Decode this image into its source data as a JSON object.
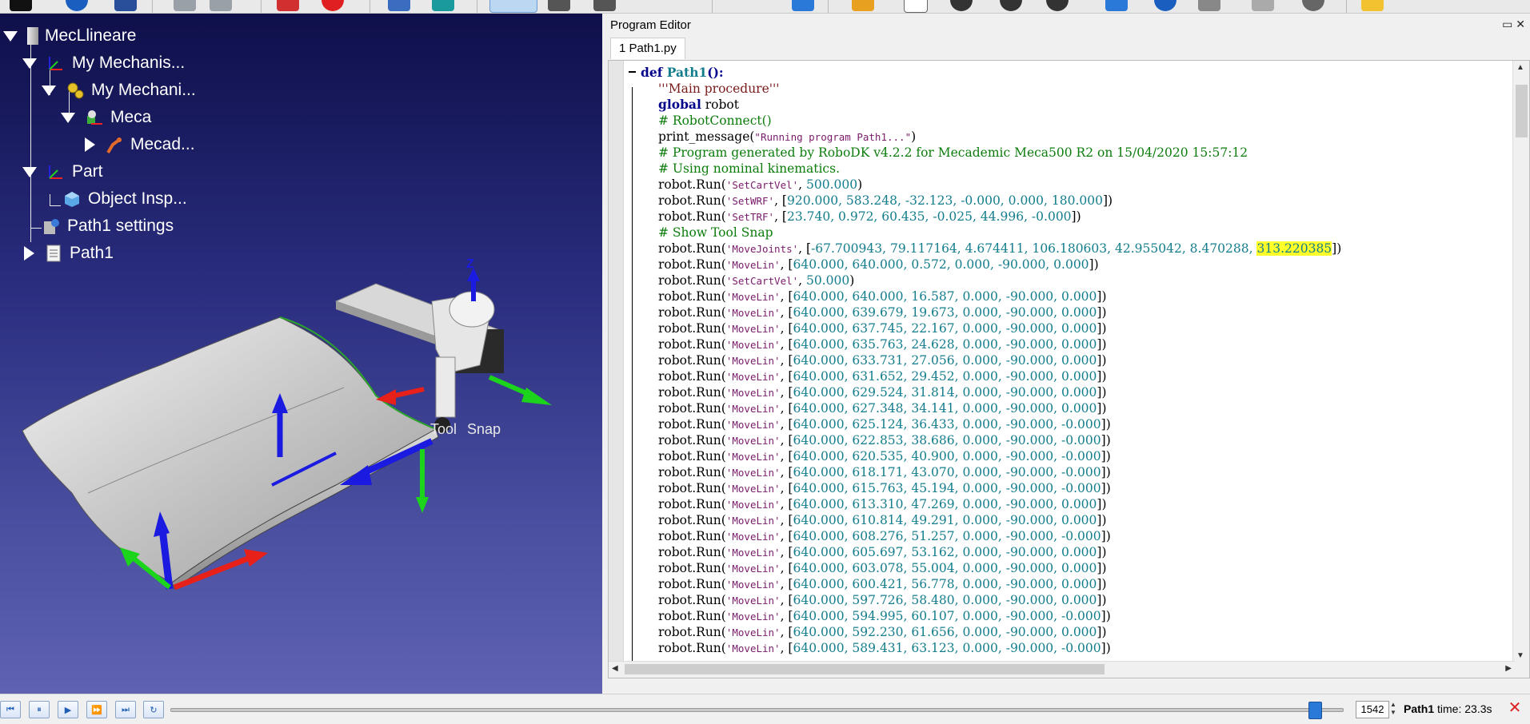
{
  "tree": {
    "items": [
      {
        "label": "MecLlineare"
      },
      {
        "label": "My Mechanis..."
      },
      {
        "label": "My Mechani..."
      },
      {
        "label": "Meca"
      },
      {
        "label": "Mecad..."
      },
      {
        "label": "Part"
      },
      {
        "label": "Object Insp..."
      },
      {
        "label": "Path1 settings"
      },
      {
        "label": "Path1"
      }
    ]
  },
  "viewport": {
    "tool_label": "Tool",
    "snap_label": "Snap",
    "colors": {
      "x_axis": "#e8201a",
      "y_axis": "#1bd41b",
      "z_axis": "#1a1ae0",
      "background": "#2a2d7e"
    }
  },
  "editor": {
    "title": "Program Editor",
    "window_buttons": "▭ ✕",
    "tab": "1 Path1.py",
    "highlight_color": "#ffff2a",
    "lines": {
      "l0": {
        "kw": "def ",
        "fn": "Path1",
        "rest": "():"
      },
      "l1": "'''Main procedure'''",
      "l2": {
        "kw": "global",
        "rest": " robot"
      },
      "l3": "# RobotConnect()",
      "l4": {
        "pre": "print_message(",
        "str": "\"Running program Path1...\"",
        "post": ")"
      },
      "l5": "# Program generated by RoboDK v4.2.2 for Mecademic Meca500 R2 on 15/04/2020 15:57:12",
      "l6": "# Using nominal kinematics.",
      "l7": {
        "str": "'SetCartVel'",
        "args": "500.000",
        "post": ")"
      },
      "l8": {
        "str": "'SetWRF'",
        "args": "920.000, 583.248, -32.123, -0.000, 0.000, 180.000",
        "post": "])"
      },
      "l9": {
        "str": "'SetTRF'",
        "args": "23.740, 0.972, 60.435, -0.025, 44.996, -0.000",
        "post": "])"
      },
      "l10": "# Show Tool Snap",
      "l11": {
        "str": "'MoveJoints'",
        "args": "-67.700943, 79.117164, 4.674411, 106.180603, 42.955042, 8.470288, ",
        "hl": "313.220385",
        "post": "])"
      },
      "l12": {
        "str": "'MoveLin'",
        "args": "640.000, 640.000, 0.572, 0.000, -90.000, 0.000",
        "post": "])"
      },
      "l13": {
        "str": "'SetCartVel'",
        "args": "50.000",
        "post": ")"
      },
      "l14": {
        "str": "'MoveLin'",
        "args": "640.000, 640.000, 16.587, 0.000, -90.000, 0.000",
        "post": "])"
      },
      "l15": {
        "str": "'MoveLin'",
        "args": "640.000, 639.679, 19.673, 0.000, -90.000, 0.000",
        "post": "])"
      },
      "l16": {
        "str": "'MoveLin'",
        "args": "640.000, 637.745, 22.167, 0.000, -90.000, 0.000",
        "post": "])"
      },
      "l17": {
        "str": "'MoveLin'",
        "args": "640.000, 635.763, 24.628, 0.000, -90.000, 0.000",
        "post": "])"
      },
      "l18": {
        "str": "'MoveLin'",
        "args": "640.000, 633.731, 27.056, 0.000, -90.000, 0.000",
        "post": "])"
      },
      "l19": {
        "str": "'MoveLin'",
        "args": "640.000, 631.652, 29.452, 0.000, -90.000, 0.000",
        "post": "])"
      },
      "l20": {
        "str": "'MoveLin'",
        "args": "640.000, 629.524, 31.814, 0.000, -90.000, 0.000",
        "post": "])"
      },
      "l21": {
        "str": "'MoveLin'",
        "args": "640.000, 627.348, 34.141, 0.000, -90.000, 0.000",
        "post": "])"
      },
      "l22": {
        "str": "'MoveLin'",
        "args": "640.000, 625.124, 36.433, 0.000, -90.000, -0.000",
        "post": "])"
      },
      "l23": {
        "str": "'MoveLin'",
        "args": "640.000, 622.853, 38.686, 0.000, -90.000, -0.000",
        "post": "])"
      },
      "l24": {
        "str": "'MoveLin'",
        "args": "640.000, 620.535, 40.900, 0.000, -90.000, -0.000",
        "post": "])"
      },
      "l25": {
        "str": "'MoveLin'",
        "args": "640.000, 618.171, 43.070, 0.000, -90.000, -0.000",
        "post": "])"
      },
      "l26": {
        "str": "'MoveLin'",
        "args": "640.000, 615.763, 45.194, 0.000, -90.000, -0.000",
        "post": "])"
      },
      "l27": {
        "str": "'MoveLin'",
        "args": "640.000, 613.310, 47.269, 0.000, -90.000, 0.000",
        "post": "])"
      },
      "l28": {
        "str": "'MoveLin'",
        "args": "640.000, 610.814, 49.291, 0.000, -90.000, 0.000",
        "post": "])"
      },
      "l29": {
        "str": "'MoveLin'",
        "args": "640.000, 608.276, 51.257, 0.000, -90.000, -0.000",
        "post": "])"
      },
      "l30": {
        "str": "'MoveLin'",
        "args": "640.000, 605.697, 53.162, 0.000, -90.000, 0.000",
        "post": "])"
      },
      "l31": {
        "str": "'MoveLin'",
        "args": "640.000, 603.078, 55.004, 0.000, -90.000, 0.000",
        "post": "])"
      },
      "l32": {
        "str": "'MoveLin'",
        "args": "640.000, 600.421, 56.778, 0.000, -90.000, 0.000",
        "post": "])"
      },
      "l33": {
        "str": "'MoveLin'",
        "args": "640.000, 597.726, 58.480, 0.000, -90.000, 0.000",
        "post": "])"
      },
      "l34": {
        "str": "'MoveLin'",
        "args": "640.000, 594.995, 60.107, 0.000, -90.000, -0.000",
        "post": "])"
      },
      "l35": {
        "str": "'MoveLin'",
        "args": "640.000, 592.230, 61.656, 0.000, -90.000, 0.000",
        "post": "])"
      },
      "l36": {
        "str": "'MoveLin'",
        "args": "640.000, 589.431, 63.123, 0.000, -90.000, -0.000",
        "post": "])"
      },
      "call_prefix": "robot.Run(",
      "arg_open": ", [",
      "arg_open_plain": ", "
    }
  },
  "timeline": {
    "frame": "1542",
    "status_name": "Path1",
    "status_time": " time: 23.3s",
    "slider_position": 0.975
  }
}
